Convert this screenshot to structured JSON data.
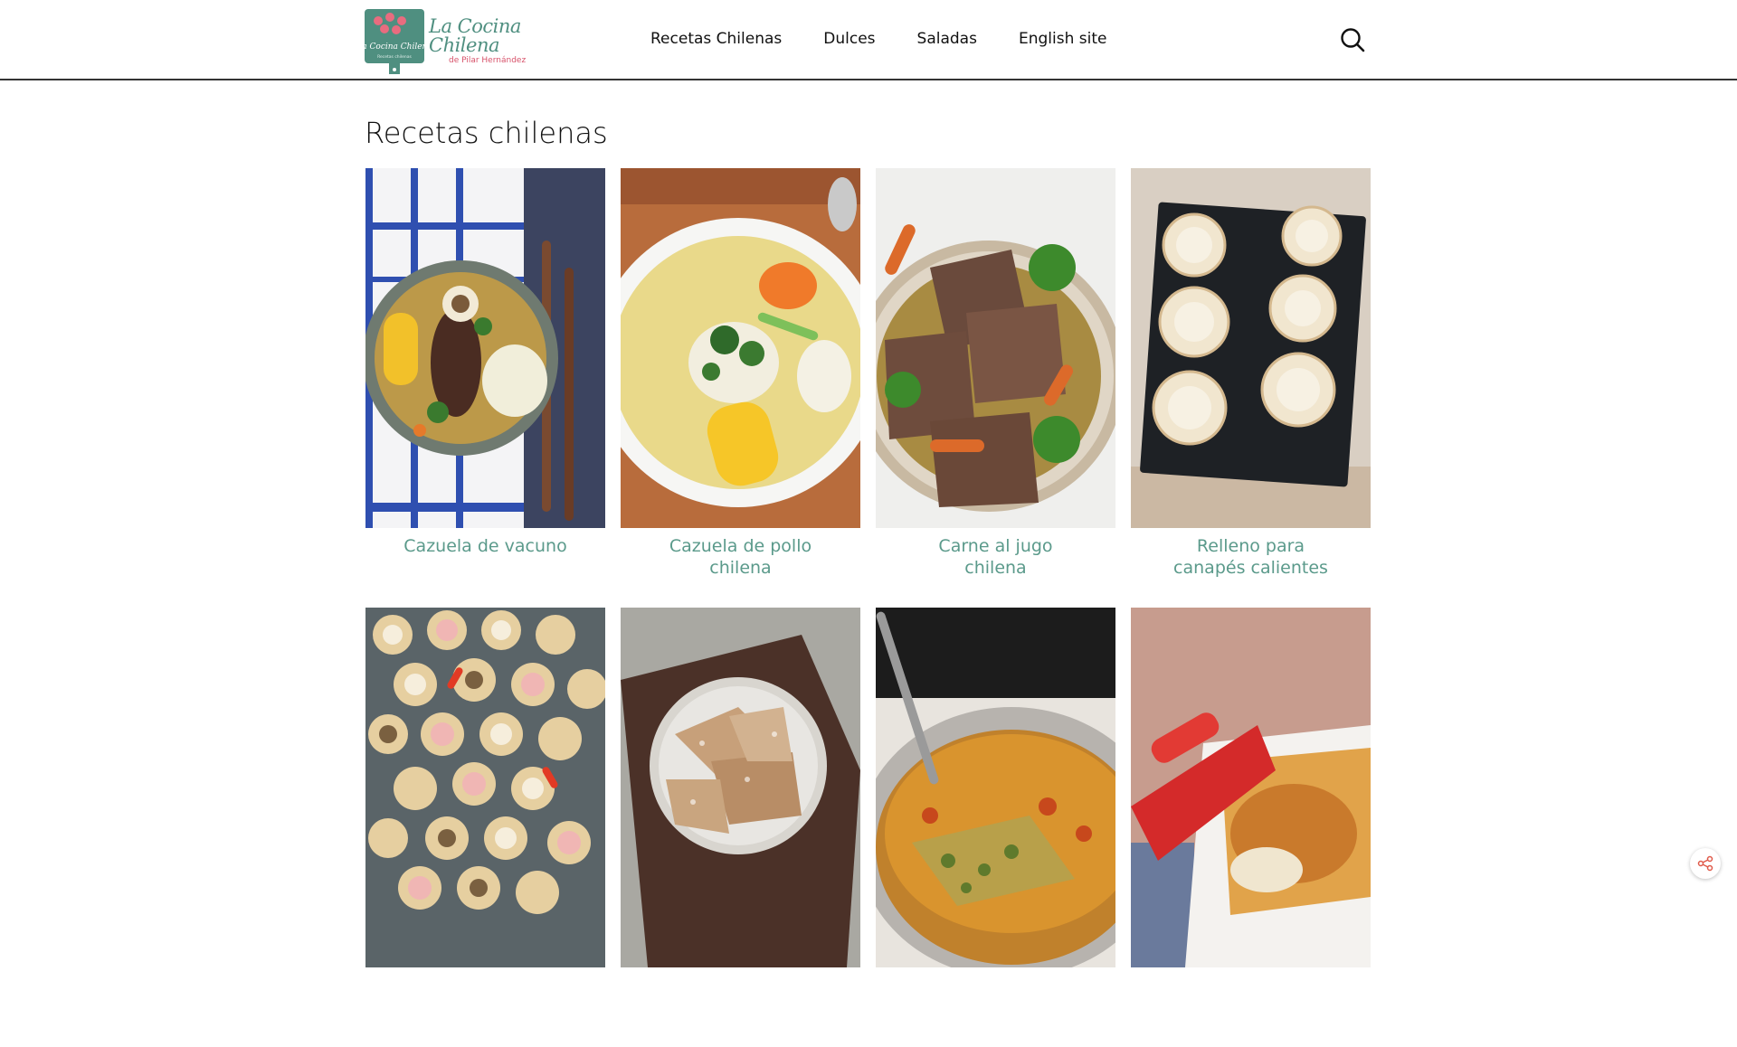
{
  "header": {
    "logo": {
      "title": "La Cocina Chilena",
      "subtitle": "de Pilar Hernández",
      "badge_text": "La Cocina Chilena",
      "badge_small": "Recetas chilenas"
    },
    "nav": [
      {
        "label": "Recetas Chilenas"
      },
      {
        "label": "Dulces"
      },
      {
        "label": "Saladas"
      },
      {
        "label": "English site"
      }
    ],
    "search_icon": "search-icon"
  },
  "main": {
    "title": "Recetas chilenas",
    "recipes": [
      {
        "title": "Cazuela de vacuno",
        "image": "beef-cazuela-photo"
      },
      {
        "title": "Cazuela de pollo chilena",
        "image": "chicken-cazuela-photo"
      },
      {
        "title": "Carne al jugo chilena",
        "image": "braised-beef-photo"
      },
      {
        "title": "Relleno para canapés calientes",
        "image": "hot-canapes-photo"
      },
      {
        "title": "",
        "image": "canapes-platter-photo"
      },
      {
        "title": "",
        "image": "calzones-rotos-photo"
      },
      {
        "title": "",
        "image": "zucchini-frittata-photo"
      },
      {
        "title": "",
        "image": "baked-casserole-photo"
      }
    ]
  },
  "share": {
    "icon": "share-icon"
  },
  "colors": {
    "accent": "#5b9a8b",
    "logo_pink": "#d7526a",
    "header_border": "#333333"
  }
}
